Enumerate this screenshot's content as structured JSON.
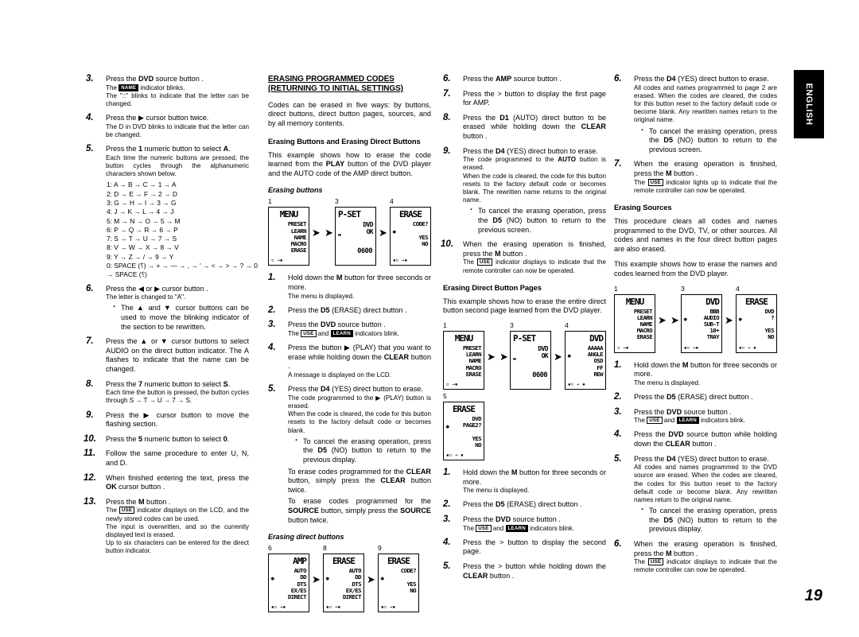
{
  "page": {
    "number": "19",
    "language_tab": "ENGLISH"
  },
  "column1": {
    "steps": [
      {
        "num": "3.",
        "main": "Press the <b>DVD</b> source button .",
        "subs": [
          "The <span class=\"chip\">NAME</span> indicator blinks.",
          "The \"::\" blinks to indicate that the letter can be changed."
        ]
      },
      {
        "num": "4.",
        "main": "Press the ▶ cursor button twice.",
        "subs": [
          "The D in DVD blinks to indicate that the letter can be changed."
        ]
      },
      {
        "num": "5.",
        "main": "Press the <b>1</b> numeric button to select <b>A</b>.",
        "subs": [
          "Each time the numeric buttons are pressed, the button cycles through the alphanumeric characters shown below."
        ]
      }
    ],
    "cycles": [
      "1: A → B → C → 1 → A",
      "2: D → E → F → 2 → D",
      "3: G → H → I → 3 → G",
      "4: J → K → L → 4 → J",
      "5: M → N → O → 5 → M",
      "6: P → Q → R → 6 → P",
      "7: S → T → U → 7 → S",
      "8: V → W → X → 8 → V",
      "9: Y → Z → / → 9 → Y",
      "0: SPACE (⸮) → + → — → , → ' → < → > → ? → 0",
      "→ SPACE (⸮)"
    ],
    "steps2": [
      {
        "num": "6.",
        "main": "Press the ◀ or ▶ cursor button .",
        "subs": [
          "The letter is changed to \"A\"."
        ],
        "bullets": [
          "The ▲ and ▼ cursor buttons can be used to move the blinking indicator of the section to be rewritten."
        ]
      },
      {
        "num": "7.",
        "main": "Press the ▲ or ▼ cursor buttons to select AUDIO on the direct button indicator. The A flashes to indicate that the name can be changed.",
        "subs": []
      },
      {
        "num": "8.",
        "main": "Press the <b>7</b> numeric button to select <b>S</b>.",
        "subs": [
          "Each time the button is pressed, the button cycles through S → T → U → 7 → S."
        ]
      },
      {
        "num": "9.",
        "main": "Press the ▶ cursor button to move the flashing section.",
        "subs": []
      },
      {
        "num": "10.",
        "main": "Press the <b>5</b> numeric button to select <b>0</b>.",
        "subs": []
      },
      {
        "num": "11.",
        "main": "Follow the same procedure to enter U, N, and D.",
        "subs": []
      },
      {
        "num": "12.",
        "main": "When finished entering the text, press the <b>OK</b> cursor button .",
        "subs": []
      },
      {
        "num": "13.",
        "main": "Press the <b>M</b> button .",
        "subs": [
          "The <span class=\"chip open\">USE</span> indicator displays on the LCD, and the newly stored codes can be used.",
          "The input is overwritten, and so the currently displayed text is erased.",
          "Up to six characters can be entered for the direct button indicator."
        ]
      }
    ]
  },
  "column2": {
    "heading": "ERASING PROGRAMMED CODES<br>(RETURNING TO INITIAL SETTINGS)",
    "intro": "Codes can be erased in five ways: by buttons, direct buttons, direct button pages, sources, and by all memory contents.",
    "sub_heading": "Erasing Buttons and Erasing Direct Buttons",
    "sub_intro": "This example shows how to erase the code learned from the <b>PLAY</b> button of the DVD player and the AUTO code of the AMP direct button.",
    "fig_label": "Erasing buttons",
    "steps": [
      {
        "num": "1.",
        "main": "Hold down the <b>M</b> button for three seconds or more.",
        "subs": [
          "The menu is displayed."
        ]
      },
      {
        "num": "2.",
        "main": "Press the <b>D5</b> (ERASE) direct button .",
        "subs": []
      },
      {
        "num": "3.",
        "main": "Press the <b>DVD</b> source button .",
        "subs": [
          "The <span class=\"chip open\">USE</span> and <span class=\"chip\">LEARN</span> indicators blink."
        ]
      },
      {
        "num": "4.",
        "main": "Press the button ▶ (PLAY) that you want to erase while holding down the <b>CLEAR</b> button .",
        "subs": [
          "A message is displayed on the LCD."
        ]
      },
      {
        "num": "5.",
        "main": "Press the <b>D4</b> (YES) direct button to erase.",
        "subs": [
          "The code programmed to the ▶ (PLAY) button is erased.",
          "When the code is cleared, the code for this button resets to the factory default code or becomes blank."
        ],
        "bullets": [
          "To cancel the erasing operation, press the <b>D5</b> (NO) button to return to the previous display."
        ],
        "extras": [
          "To erase codes programmed for the <b>CLEAR</b> button, simply press the <b>CLEAR</b> button twice.",
          "To erase codes programmed for the <b>SOURCE</b> button, simply press the <b>SOURCE</b> button twice."
        ]
      }
    ],
    "fig_label2": "Erasing direct buttons"
  },
  "column3": {
    "steps": [
      {
        "num": "6.",
        "main": "Press the <b>AMP</b> source button .",
        "subs": []
      },
      {
        "num": "7.",
        "main": "Press the > button to display the first page for AMP.",
        "subs": []
      },
      {
        "num": "8.",
        "main": "Press the <b>D1</b> (AUTO) direct button to be erased while holding down the <b>CLEAR</b> button .",
        "subs": []
      },
      {
        "num": "9.",
        "main": "Press the <b>D4</b> (YES) direct button to erase.",
        "subs": [
          "The code programmed to the <b>AUTO</b> button is erased.",
          "When the code is cleared, the code for this button resets to the factory default code or becomes blank. The rewritten name returns to the original name."
        ],
        "bullets": [
          "To cancel the erasing operation, press the <b>D5</b> (NO) button to return to the previous screen."
        ]
      },
      {
        "num": "10.",
        "main": "When the erasing operation is finished, press the <b>M</b> button .",
        "subs": [
          "The <span class=\"chip open\">USE</span> indicator displays to indicate that the remote controller can now be operated."
        ]
      }
    ],
    "sub_heading": "Erasing Direct Button Pages",
    "sub_intro": "This example shows how to erase the entire direct button second page learned from the DVD player.",
    "steps2": [
      {
        "num": "1.",
        "main": "Hold down the <b>M</b> button for three seconds or more.",
        "subs": [
          "The menu is displayed."
        ]
      },
      {
        "num": "2.",
        "main": "Press the <b>D5</b> (ERASE) direct button .",
        "subs": []
      },
      {
        "num": "3.",
        "main": "Press the <b>DVD</b> source button .",
        "subs": [
          "The <span class=\"chip open\">USE</span> and <span class=\"chip\">LEARN</span> indicators blink."
        ]
      },
      {
        "num": "4.",
        "main": "Press the > button to display the second page.",
        "subs": []
      },
      {
        "num": "5.",
        "main": "Press the > button while holding down the <b>CLEAR</b> button .",
        "subs": []
      }
    ]
  },
  "column4": {
    "steps": [
      {
        "num": "6.",
        "main": "Press the <b>D4</b> (YES) direct button to erase.",
        "subs": [
          "All codes and names programmed to page 2 are erased. When the codes are cleared, the codes for this button reset to the factory default code or become blank. Any rewritten names return to the original name."
        ],
        "bullets": [
          "To cancel the erasing operation, press the <b>D5</b> (NO) button to return to the previous screen."
        ]
      },
      {
        "num": "7.",
        "main": "When the erasing operation is finished, press the <b>M</b> button .",
        "subs": [
          "The <span class=\"chip open\">USE</span> indicator lights up to indicate that the remote controller can now be operated."
        ]
      }
    ],
    "sub_heading": "Erasing Sources",
    "sub_intro": "This procedure clears all codes and names programmed to the DVD, TV, or other sources. All codes and names in the four direct button pages are also erased.",
    "sub_intro2": "This example shows how to erase the names and codes learned from the DVD player.",
    "steps2": [
      {
        "num": "1.",
        "main": "Hold down the <b>M</b> button for three seconds or more.",
        "subs": [
          "The menu is displayed."
        ]
      },
      {
        "num": "2.",
        "main": "Press the <b>D5</b> (ERASE) direct button .",
        "subs": []
      },
      {
        "num": "3.",
        "main": "Press the <b>DVD</b> source button .",
        "subs": [
          "The <span class=\"chip open\">USE</span> and <span class=\"chip\">LEARN</span> indicators blink."
        ]
      },
      {
        "num": "4.",
        "main": "Press the <b>DVD</b> source button while holding down the <b>CLEAR</b> button .",
        "subs": []
      },
      {
        "num": "5.",
        "main": "Press the <b>D4</b> (YES) direct button to erase.",
        "subs": [
          "All codes and names programmed to the DVD source are erased. When the codes are cleared, the codes for this button reset to the factory default code or become blank. Any rewritten names return to the original name."
        ],
        "bullets": [
          "To cancel the erasing operation, press the <b>D5</b> (NO) button to return to the previous display."
        ]
      },
      {
        "num": "6.",
        "main": "When the erasing operation is finished, press the <b>M</b> button .",
        "subs": [
          "The <span class=\"chip open\">USE</span> indicator displays to indicate that the remote controller can now be operated."
        ]
      }
    ]
  },
  "lcd_figures": {
    "erasing_buttons": [
      {
        "step": "1",
        "title": "MENU",
        "title_align": "center",
        "lines": [
          "PRESET",
          "LEARN",
          "NAME",
          "MACRO",
          "ERASE"
        ],
        "bottom": "▫  →▪"
      },
      {
        "step": "3",
        "title": "P-SET",
        "title_align": "left",
        "lines": [
          "DVD",
          "OK"
        ],
        "code": "0600",
        "leftmark": "▬"
      },
      {
        "step": "4",
        "title": "ERASE",
        "title_align": "center",
        "lines": [
          "CODE?",
          "",
          "YES",
          "NO"
        ],
        "blink_left": true,
        "bottom": "▫ →▪"
      }
    ],
    "erasing_direct_buttons": [
      {
        "step": "6",
        "title": "AMP",
        "title_align": "right",
        "lines": [
          "AUTO",
          "DD",
          "DTS",
          "EX/ES",
          "DIRECT"
        ],
        "blink_left": true,
        "bottom": "▫ →▪"
      },
      {
        "step": "8",
        "title": "ERASE",
        "title_align": "center",
        "lines": [
          "AUTO",
          "DD",
          "DTS",
          "EX/ES",
          "DIRECT"
        ],
        "blink_left": true,
        "bottom": "▫ →▪"
      },
      {
        "step": "9",
        "title": "ERASE",
        "title_align": "center",
        "lines": [
          "CODE?",
          "",
          "YES",
          "NO"
        ],
        "blink_left": true,
        "bottom": "▫ →▪"
      }
    ],
    "erasing_pages": [
      {
        "step": "1",
        "title": "MENU",
        "title_align": "center",
        "lines": [
          "PRESET",
          "LEARN",
          "NAME",
          "MACRO",
          "ERASE"
        ],
        "bottom": "▫  →▪"
      },
      {
        "step": "3",
        "title": "P-SET",
        "title_align": "left",
        "lines": [
          "DVD",
          "OK"
        ],
        "code": "0600",
        "leftmark": "▬"
      },
      {
        "step": "4",
        "title": "DVD",
        "title_align": "right",
        "lines": [
          "AAAAA",
          "ANGLE",
          "OSD",
          "FF",
          "REW"
        ],
        "blink_left": true,
        "bottom": "▫ → ▪"
      },
      {
        "step": "5",
        "title": "ERASE",
        "title_align": "center",
        "lines": [
          "DVD",
          "PAGE2?",
          "",
          "YES",
          "NO"
        ],
        "blink_left": true,
        "bottom": "▫ → ▪"
      }
    ],
    "erasing_sources": [
      {
        "step": "1",
        "title": "MENU",
        "title_align": "center",
        "lines": [
          "PRESET",
          "LEARN",
          "NAME",
          "MACRO",
          "ERASE"
        ],
        "bottom": "▫  →▪"
      },
      {
        "step": "3",
        "title": "DVD",
        "title_align": "right",
        "lines": [
          "BBB",
          "AUDIO",
          "SUB-T",
          "10+",
          "TRAY"
        ],
        "blink_left": true,
        "bottom": "▫ →▪"
      },
      {
        "step": "4",
        "title": "ERASE",
        "title_align": "center",
        "lines": [
          "DVD",
          "?",
          "",
          "YES",
          "NO"
        ],
        "blink_left": true,
        "bottom": "▫ → ▪"
      }
    ]
  }
}
